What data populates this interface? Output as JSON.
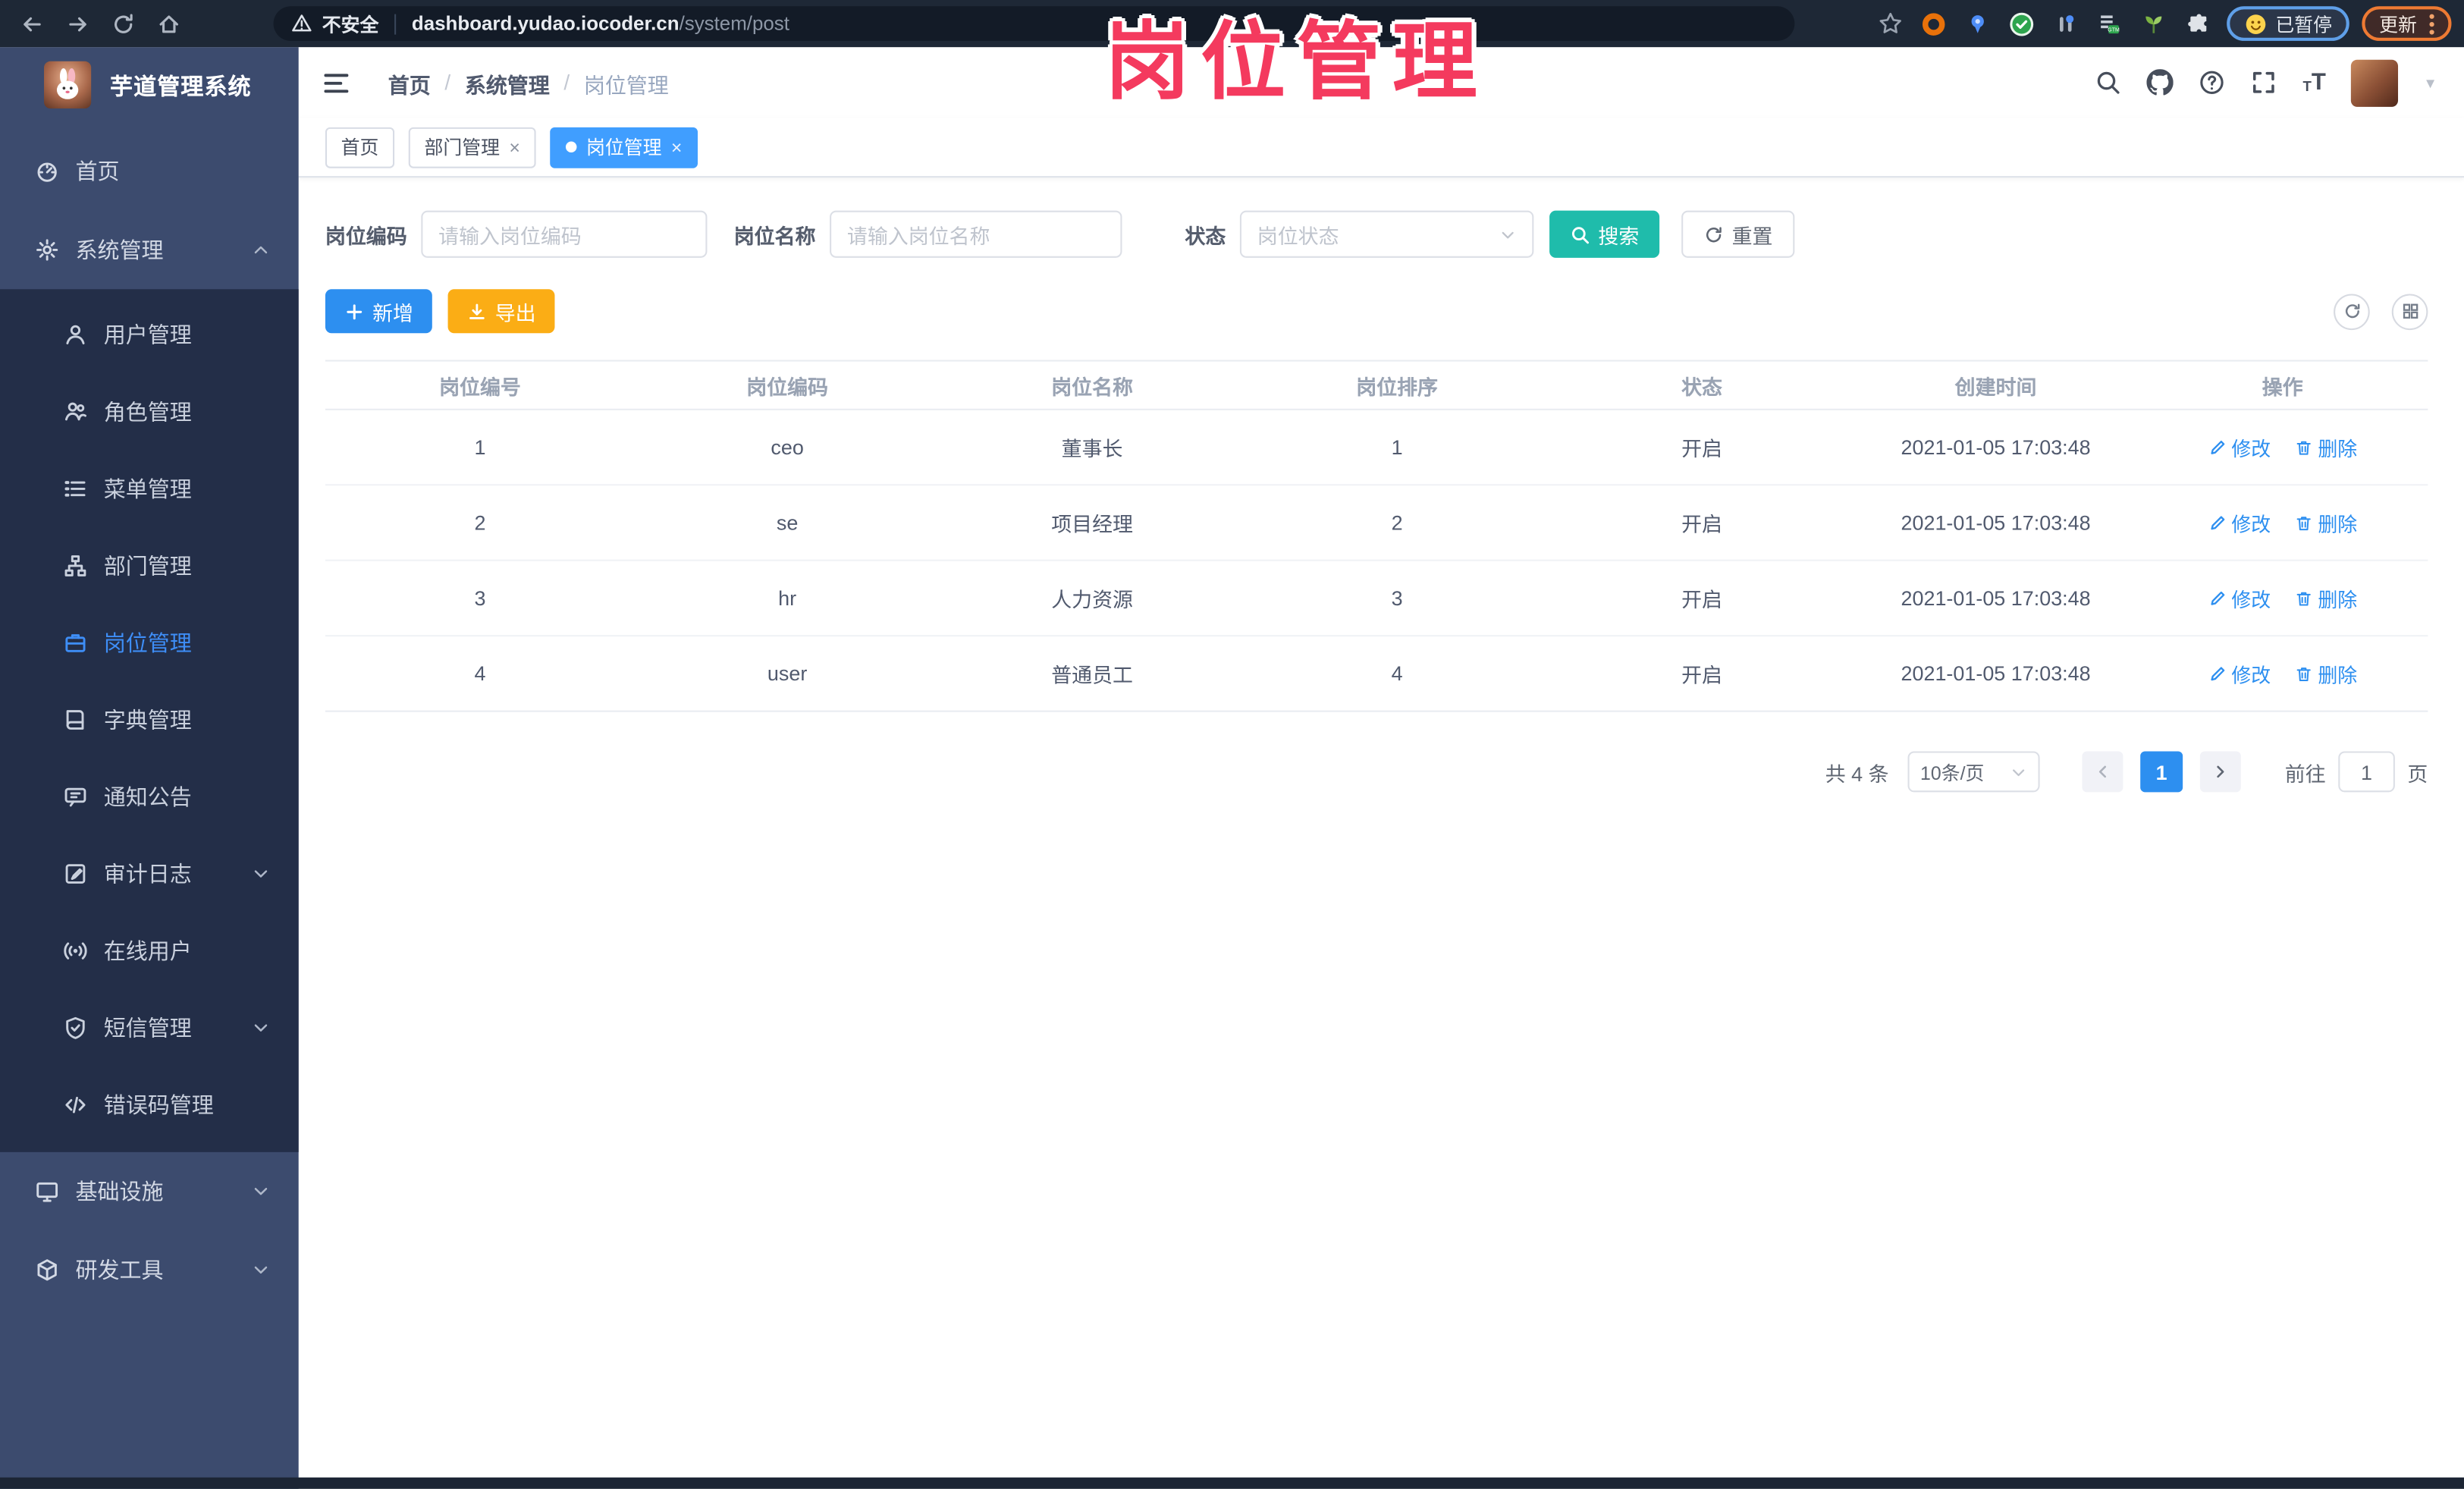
{
  "watermark": {
    "label": "岗位管理"
  },
  "browser": {
    "security_label": "不安全",
    "url_host": "dashboard.yudao.iocoder.cn",
    "url_path": "/system/post",
    "paused_label": "已暂停",
    "update_label": "更新"
  },
  "sidebar": {
    "app_title": "芋道管理系统",
    "menu": [
      {
        "label": "首页",
        "icon": "home-icon",
        "level": "top"
      },
      {
        "label": "系统管理",
        "icon": "gear-icon",
        "level": "top",
        "chevron": "up",
        "expanded": true
      },
      {
        "label": "用户管理",
        "icon": "user-icon",
        "level": "sub"
      },
      {
        "label": "角色管理",
        "icon": "role-icon",
        "level": "sub"
      },
      {
        "label": "菜单管理",
        "icon": "menu-icon",
        "level": "sub"
      },
      {
        "label": "部门管理",
        "icon": "dept-icon",
        "level": "sub"
      },
      {
        "label": "岗位管理",
        "icon": "post-icon",
        "level": "sub",
        "active": true
      },
      {
        "label": "字典管理",
        "icon": "dict-icon",
        "level": "sub"
      },
      {
        "label": "通知公告",
        "icon": "notice-icon",
        "level": "sub"
      },
      {
        "label": "审计日志",
        "icon": "audit-icon",
        "level": "sub",
        "chevron": "down"
      },
      {
        "label": "在线用户",
        "icon": "online-icon",
        "level": "sub"
      },
      {
        "label": "短信管理",
        "icon": "sms-icon",
        "level": "sub",
        "chevron": "down"
      },
      {
        "label": "错误码管理",
        "icon": "errcode-icon",
        "level": "sub"
      },
      {
        "label": "基础设施",
        "icon": "infra-icon",
        "level": "top",
        "chevron": "down"
      },
      {
        "label": "研发工具",
        "icon": "tools-icon",
        "level": "top",
        "chevron": "down"
      }
    ]
  },
  "header": {
    "breadcrumb": [
      "首页",
      "系统管理",
      "岗位管理"
    ]
  },
  "tabs": [
    {
      "label": "首页",
      "active": false,
      "closable": false
    },
    {
      "label": "部门管理",
      "active": false,
      "closable": true
    },
    {
      "label": "岗位管理",
      "active": true,
      "closable": true
    }
  ],
  "filters": {
    "post_code_label": "岗位编码",
    "post_code_placeholder": "请输入岗位编码",
    "post_name_label": "岗位名称",
    "post_name_placeholder": "请输入岗位名称",
    "status_label": "状态",
    "status_placeholder": "岗位状态",
    "search_label": "搜索",
    "reset_label": "重置"
  },
  "toolbar": {
    "add_label": "新增",
    "export_label": "导出"
  },
  "table": {
    "columns": [
      "岗位编号",
      "岗位编码",
      "岗位名称",
      "岗位排序",
      "状态",
      "创建时间",
      "操作"
    ],
    "rows": [
      {
        "id": "1",
        "code": "ceo",
        "name": "董事长",
        "sort": "1",
        "status": "开启",
        "created": "2021-01-05 17:03:48"
      },
      {
        "id": "2",
        "code": "se",
        "name": "项目经理",
        "sort": "2",
        "status": "开启",
        "created": "2021-01-05 17:03:48"
      },
      {
        "id": "3",
        "code": "hr",
        "name": "人力资源",
        "sort": "3",
        "status": "开启",
        "created": "2021-01-05 17:03:48"
      },
      {
        "id": "4",
        "code": "user",
        "name": "普通员工",
        "sort": "4",
        "status": "开启",
        "created": "2021-01-05 17:03:48"
      }
    ],
    "edit_label": "修改",
    "delete_label": "删除"
  },
  "pagination": {
    "total_label": "共 4 条",
    "page_size_label": "10条/页",
    "current_page": "1",
    "goto_label": "前往",
    "goto_value": "1",
    "page_unit_label": "页"
  },
  "colors": {
    "accent": "#409eff",
    "search_teal": "#1fbcab",
    "export_orange": "#fbad15",
    "watermark_pink": "#f43a5e"
  }
}
